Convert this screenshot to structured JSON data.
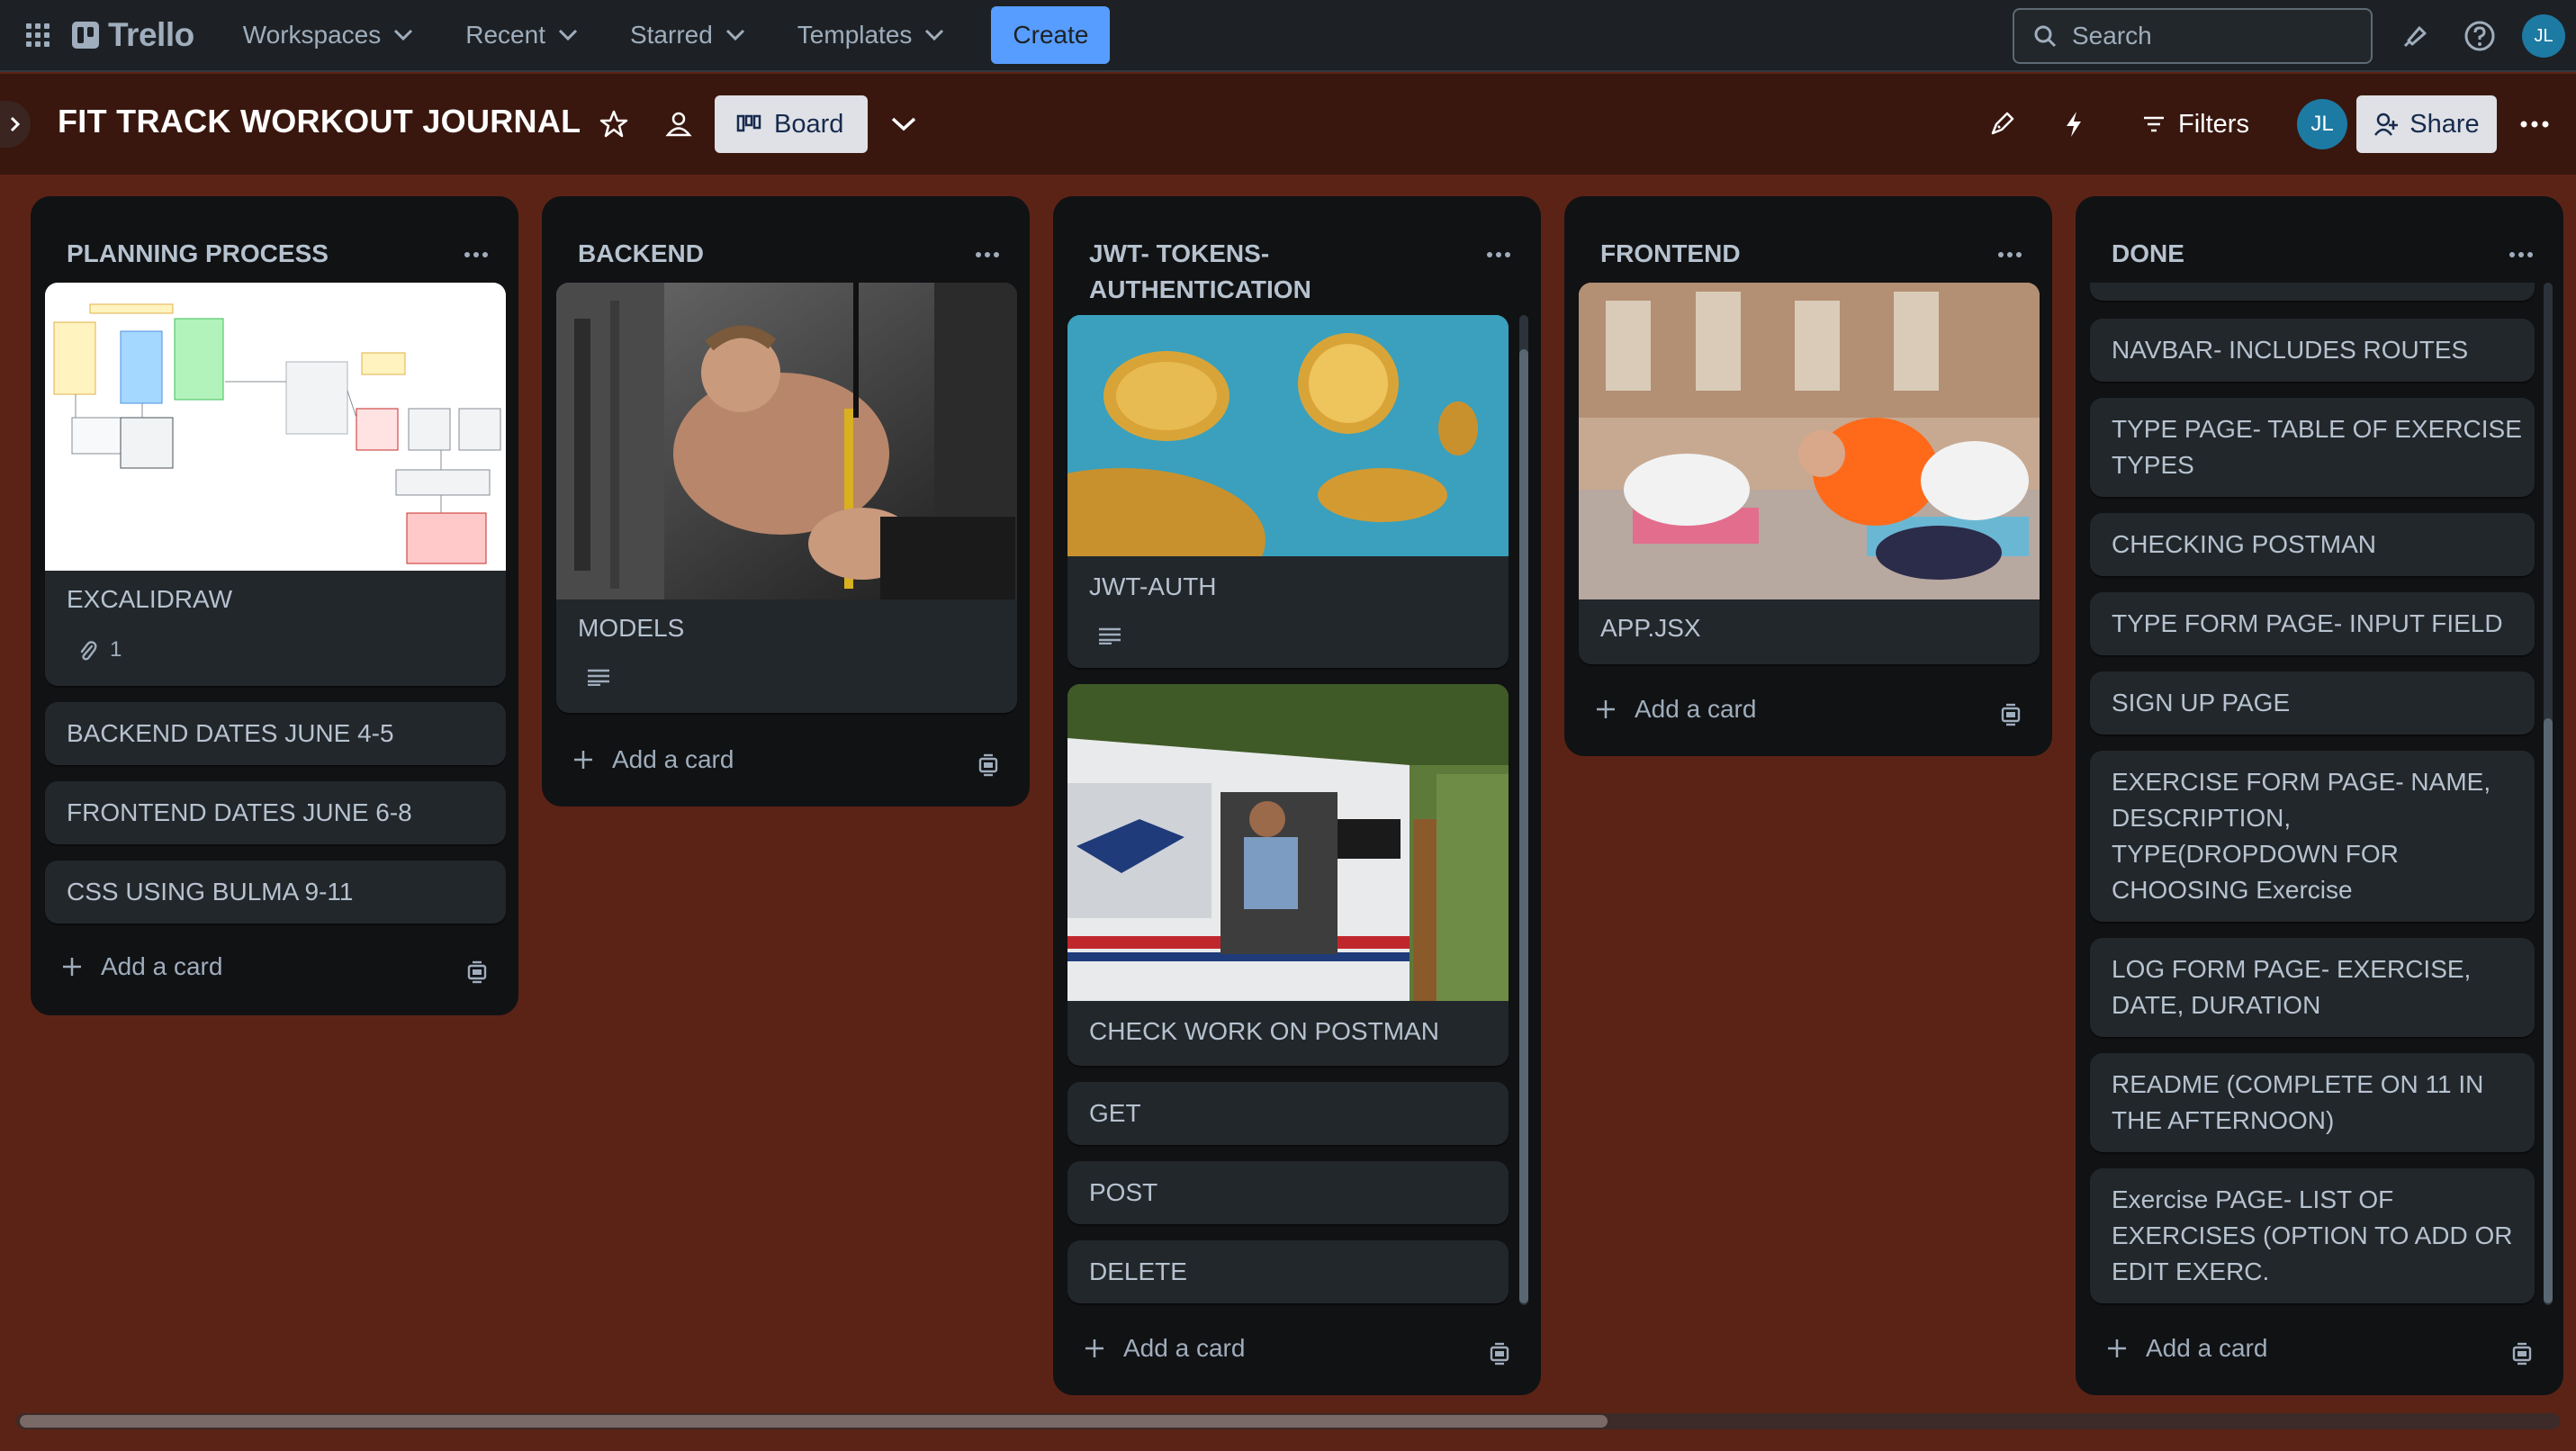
{
  "topnav": {
    "logo": "Trello",
    "menu": [
      {
        "label": "Workspaces"
      },
      {
        "label": "Recent"
      },
      {
        "label": "Starred"
      },
      {
        "label": "Templates"
      }
    ],
    "create_label": "Create",
    "search_placeholder": "Search",
    "user_initials": "JL"
  },
  "board": {
    "title": "FIT TRACK WORKOUT JOURNAL",
    "view_label": "Board",
    "filters_label": "Filters",
    "share_label": "Share",
    "member_initials": "JL"
  },
  "lists": [
    {
      "title": "PLANNING PROCESS",
      "cards": [
        {
          "title": "EXCALIDRAW",
          "attachments": "1"
        },
        {
          "title": "BACKEND DATES JUNE 4-5"
        },
        {
          "title": "FRONTEND DATES JUNE 6-8"
        },
        {
          "title": "CSS USING BULMA 9-11"
        }
      ],
      "add_label": "Add a card"
    },
    {
      "title": "BACKEND",
      "cards": [
        {
          "title": "MODELS"
        }
      ],
      "add_label": "Add a card"
    },
    {
      "title": "JWT- TOKENS-AUTHENTICATION",
      "title_line1": "JWT- TOKENS-",
      "title_line2": "AUTHENTICATION",
      "cards": [
        {
          "title": "JWT-AUTH"
        },
        {
          "title": "CHECK WORK ON POSTMAN"
        },
        {
          "title": "GET"
        },
        {
          "title": "POST"
        },
        {
          "title": "DELETE"
        }
      ],
      "add_label": "Add a card"
    },
    {
      "title": "FRONTEND",
      "cards": [
        {
          "title": "APP.JSX"
        }
      ],
      "add_label": "Add a card"
    },
    {
      "title": "DONE",
      "cards": [
        {
          "title": "NAVBAR- INCLUDES ROUTES"
        },
        {
          "title": "TYPE PAGE- TABLE OF EXERCISE TYPES",
          "l1": "TYPE PAGE- TABLE OF EXERCISE",
          "l2": "TYPES"
        },
        {
          "title": "CHECKING POSTMAN"
        },
        {
          "title": "TYPE FORM PAGE- INPUT FIELD"
        },
        {
          "title": "SIGN UP PAGE"
        },
        {
          "title": "EXERCISE FORM PAGE- NAME, DESCRIPTION, TYPE(DROPDOWN FOR CHOOSING Exercise",
          "l1": "EXERCISE FORM PAGE- NAME,",
          "l2": "DESCRIPTION,",
          "l3": "TYPE(DROPDOWN FOR",
          "l4": "CHOOSING Exercise"
        },
        {
          "title": "LOG FORM PAGE- EXERCISE, DATE, DURATION",
          "l1": "LOG FORM PAGE- EXERCISE,",
          "l2": "DATE, DURATION"
        },
        {
          "title": "README (COMPLETE ON 11 IN THE AFTERNOON)",
          "l1": "README (COMPLETE ON 11 IN",
          "l2": "THE AFTERNOON)"
        },
        {
          "title": "Exercise PAGE- LIST OF EXERCISES (OPTION TO ADD OR EDIT EXERC.",
          "l1": "Exercise PAGE- LIST OF",
          "l2": "EXERCISES (OPTION TO ADD OR",
          "l3": "EDIT EXERC."
        }
      ],
      "add_label": "Add a card"
    }
  ],
  "colors": {
    "board_bg": "#5b2316",
    "topnav_bg": "#1d2125",
    "list_bg": "#111214",
    "card_bg": "#22272b",
    "accent": "#579dff"
  }
}
